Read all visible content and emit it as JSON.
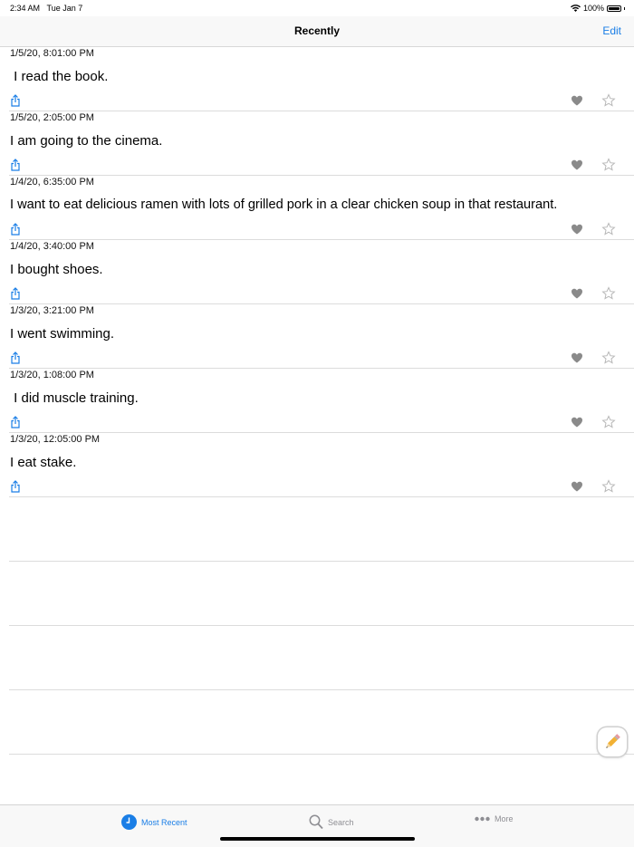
{
  "status_bar": {
    "time": "2:34 AM",
    "date": "Tue Jan 7",
    "battery": "100%"
  },
  "nav": {
    "title": "Recently",
    "edit_label": "Edit"
  },
  "entries": [
    {
      "date": "1/5/20, 8:01:00 PM",
      "text": " I read the book."
    },
    {
      "date": "1/5/20, 2:05:00 PM",
      "text": "I am going to the cinema."
    },
    {
      "date": "1/4/20, 6:35:00 PM",
      "text": "I want to eat delicious ramen with lots of grilled pork in a clear chicken soup in that restaurant."
    },
    {
      "date": "1/4/20, 3:40:00 PM",
      "text": "I bought shoes."
    },
    {
      "date": "1/3/20, 3:21:00 PM",
      "text": "I went swimming."
    },
    {
      "date": "1/3/20, 1:08:00 PM",
      "text": " I did muscle training."
    },
    {
      "date": "1/3/20, 12:05:00 PM",
      "text": "I eat stake."
    }
  ],
  "icons": {
    "share": "share-icon",
    "heart": "heart-icon",
    "star": "star-icon",
    "compose": "pencil-icon"
  },
  "tabs": [
    {
      "label": "Most Recent",
      "icon": "clock-icon",
      "selected": true
    },
    {
      "label": "Search",
      "icon": "magnifier-icon",
      "selected": false
    },
    {
      "label": "More",
      "icon": "ellipsis-icon",
      "selected": false
    }
  ],
  "colors": {
    "accent": "#1a7ee6",
    "heart": "#8a8a8a",
    "inactive_tab": "#8e8e93"
  }
}
